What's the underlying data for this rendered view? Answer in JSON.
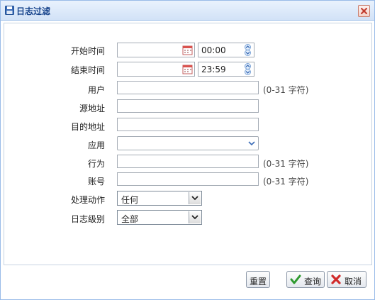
{
  "dialog": {
    "title": "日志过滤",
    "title_color": "#15428b",
    "border_color": "#99bbe8"
  },
  "form": {
    "start_time_label": "开始时间",
    "start_time_value": "00:00",
    "end_time_label": "结束时间",
    "end_time_value": "23:59",
    "user_label": "用户",
    "user_hint": "(0-31 字符)",
    "source_addr_label": "源地址",
    "dest_addr_label": "目的地址",
    "app_label": "应用",
    "behavior_label": "行为",
    "behavior_hint": "(0-31 字符)",
    "account_label": "账号",
    "account_hint": "(0-31 字符)",
    "action_label": "处理动作",
    "action_value": "任何",
    "log_level_label": "日志级别",
    "log_level_value": "全部"
  },
  "buttons": {
    "reset_label": "重置",
    "query_label": "查询",
    "cancel_label": "取消"
  },
  "icons": [
    "save-disk-icon",
    "close-icon",
    "calendar-icon",
    "spinner-icon",
    "chevron-down-icon",
    "check-icon",
    "x-icon"
  ]
}
